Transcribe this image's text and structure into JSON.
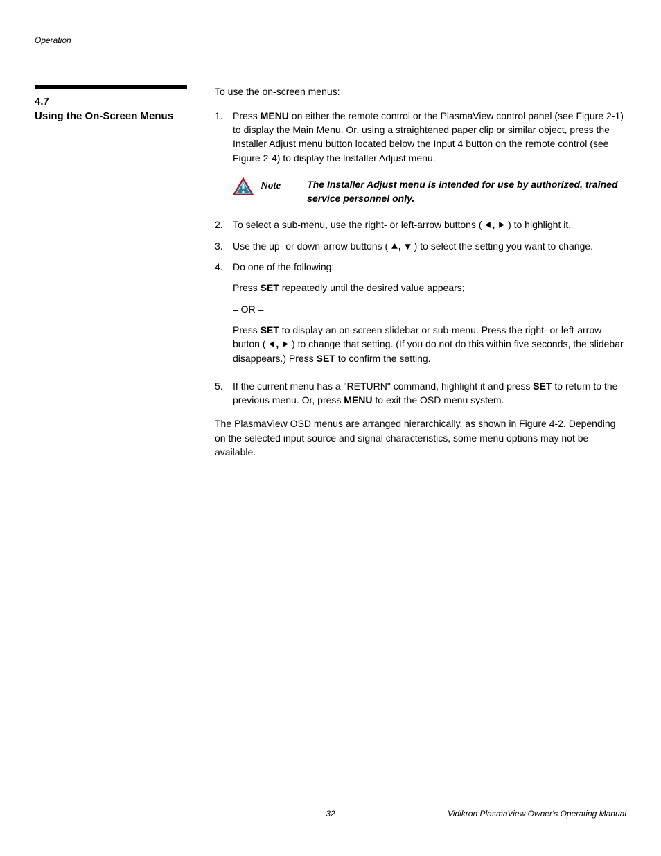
{
  "header": {
    "section": "Operation"
  },
  "sidebar": {
    "number": "4.7",
    "title": "Using the On-Screen Menus"
  },
  "intro": "To use the on-screen menus:",
  "steps": {
    "s1_a": "Press ",
    "s1_b": "MENU",
    "s1_c": " on either the remote control or the PlasmaView control panel (see Figure 2-1) to display the Main Menu. Or, using a straightened paper clip or similar object, press the Installer Adjust menu button located below the Input 4 button on the remote control (see Figure 2-4) to display the Installer Adjust menu.",
    "note_label": "Note",
    "note_text": "The Installer Adjust menu is intended for use by authorized, trained service personnel only.",
    "s2_a": "To select a sub-menu, use the right- or left-arrow buttons (",
    "s2_b": ") to highlight it.",
    "s3_a": "Use the up- or down-arrow buttons (",
    "s3_b": ") to select the setting you want to change.",
    "s4": "Do one of the following:",
    "s4_p1_a": "Press ",
    "s4_p1_b": "SET",
    "s4_p1_c": " repeatedly until the desired value appears;",
    "s4_or": "– OR –",
    "s4_p2_a": "Press ",
    "s4_p2_b": "SET",
    "s4_p2_c": " to display an on-screen slidebar or sub-menu. Press the right- or left-arrow button (",
    "s4_p2_d": ") to change that setting. (If you do not do this within five seconds, the slidebar disappears.) Press ",
    "s4_p2_e": "SET",
    "s4_p2_f": " to confirm the setting.",
    "s5_a": "If the current menu has a \"RETURN\" command, highlight it and press ",
    "s5_b": "SET",
    "s5_c": " to return to the previous menu. Or, press ",
    "s5_d": "MENU",
    "s5_e": " to exit the OSD menu system."
  },
  "closing": "The PlasmaView OSD menus are arranged hierarchically, as shown in Figure 4-2. Depending on the selected input source and signal characteristics, some menu options may not be available.",
  "footer": {
    "page": "32",
    "manual": "Vidikron PlasmaView Owner's Operating Manual"
  },
  "nums": {
    "n1": "1.",
    "n2": "2.",
    "n3": "3.",
    "n4": "4.",
    "n5": "5."
  },
  "sep": ", "
}
